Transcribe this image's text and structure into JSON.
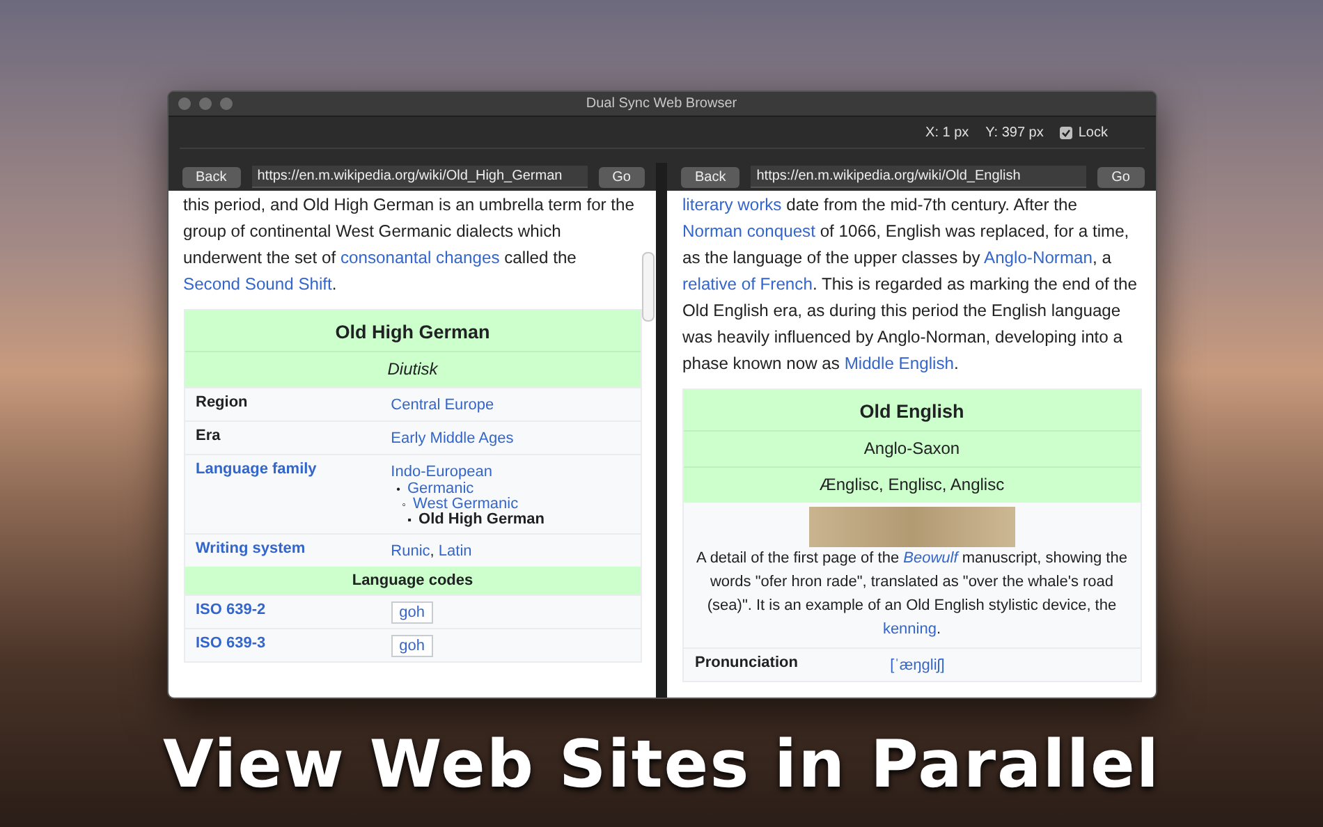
{
  "window": {
    "title": "Dual Sync Web Browser"
  },
  "toolbar": {
    "x_reading": "X: 1 px",
    "y_reading": "Y: 397 px",
    "lock": {
      "label": "Lock",
      "checked": true
    }
  },
  "panes": [
    {
      "back": "Back",
      "url": "https://en.m.wikipedia.org/wiki/Old_High_German",
      "go": "Go",
      "scrollbar": true,
      "paragraph": [
        {
          "text": "this period, and Old High German is an umbrella term for the group of continental West Germanic dialects which underwent the set of ",
          "link": false
        },
        {
          "text": "consonantal changes",
          "link": true
        },
        {
          "text": " called the ",
          "link": false
        },
        {
          "text": "Second Sound Shift",
          "link": true
        },
        {
          "text": ".",
          "link": false
        }
      ],
      "infobox": {
        "title": "Old High German",
        "subtitles": [
          {
            "text": "Diutisk",
            "italic": true
          }
        ],
        "rows": [
          {
            "kind": "field",
            "label": "Region",
            "label_link": false,
            "value": [
              {
                "text": "Central Europe",
                "link": true
              }
            ]
          },
          {
            "kind": "field",
            "label": "Era",
            "label_link": false,
            "value": [
              {
                "text": "Early Middle Ages",
                "link": true
              }
            ]
          },
          {
            "kind": "field",
            "label": "Language family",
            "label_link": true,
            "value": [
              {
                "text": "Indo-European",
                "link": true
              }
            ],
            "tree": [
              {
                "marker": "•",
                "text": "Germanic",
                "link": true,
                "children": [
                  {
                    "marker": "◦",
                    "text": "West Germanic",
                    "link": true,
                    "children": [
                      {
                        "marker": "▪",
                        "text": "Old High German",
                        "link": false
                      }
                    ]
                  }
                ]
              }
            ]
          },
          {
            "kind": "field",
            "label": "Writing system",
            "label_link": true,
            "value": [
              {
                "text": "Runic",
                "link": true
              },
              {
                "text": ", ",
                "link": false
              },
              {
                "text": "Latin",
                "link": true
              }
            ]
          },
          {
            "kind": "header",
            "label": "Language codes"
          },
          {
            "kind": "code",
            "label": "ISO 639-2",
            "label_link": true,
            "value": [
              {
                "text": "goh",
                "link": true
              }
            ]
          },
          {
            "kind": "code",
            "label": "ISO 639-3",
            "label_link": true,
            "value": [
              {
                "text": "goh",
                "link": true
              }
            ]
          }
        ]
      }
    },
    {
      "back": "Back",
      "url": "https://en.m.wikipedia.org/wiki/Old_English",
      "go": "Go",
      "scrollbar": false,
      "paragraph": [
        {
          "text": "literary works",
          "link": true
        },
        {
          "text": " date from the mid-7th century. After the ",
          "link": false
        },
        {
          "text": "Norman conquest",
          "link": true
        },
        {
          "text": " of 1066, English was replaced, for a time, as the language of the upper classes by ",
          "link": false
        },
        {
          "text": "Anglo-Norman",
          "link": true
        },
        {
          "text": ", a ",
          "link": false
        },
        {
          "text": "relative of French",
          "link": true
        },
        {
          "text": ". This is regarded as marking the end of the Old English era, as during this period the English language was heavily influenced by Anglo-Norman, developing into a phase known now as ",
          "link": false
        },
        {
          "text": "Middle English",
          "link": true
        },
        {
          "text": ".",
          "link": false
        }
      ],
      "infobox": {
        "title": "Old English",
        "subtitles": [
          {
            "text": "Anglo-Saxon",
            "italic": false
          },
          {
            "text": "Ænglisc, Englisc, Anglisc",
            "italic": false
          }
        ],
        "figure": {
          "caption": [
            {
              "text": "A detail of the first page of the ",
              "link": false
            },
            {
              "text": "Beowulf",
              "link": true,
              "italic": true
            },
            {
              "text": " manuscript, showing the words \"ofer hron rade\", translated as \"over the whale's road (sea)\". It is an example of an Old English stylistic device, the ",
              "link": false
            },
            {
              "text": "kenning",
              "link": true
            },
            {
              "text": ".",
              "link": false
            }
          ]
        },
        "rows": [
          {
            "kind": "field",
            "label": "Pronunciation",
            "label_link": false,
            "value": [
              {
                "text": "[ˈæŋgliʃ]",
                "link": true
              }
            ]
          }
        ]
      }
    }
  ],
  "caption": "View Web Sites in Parallel"
}
